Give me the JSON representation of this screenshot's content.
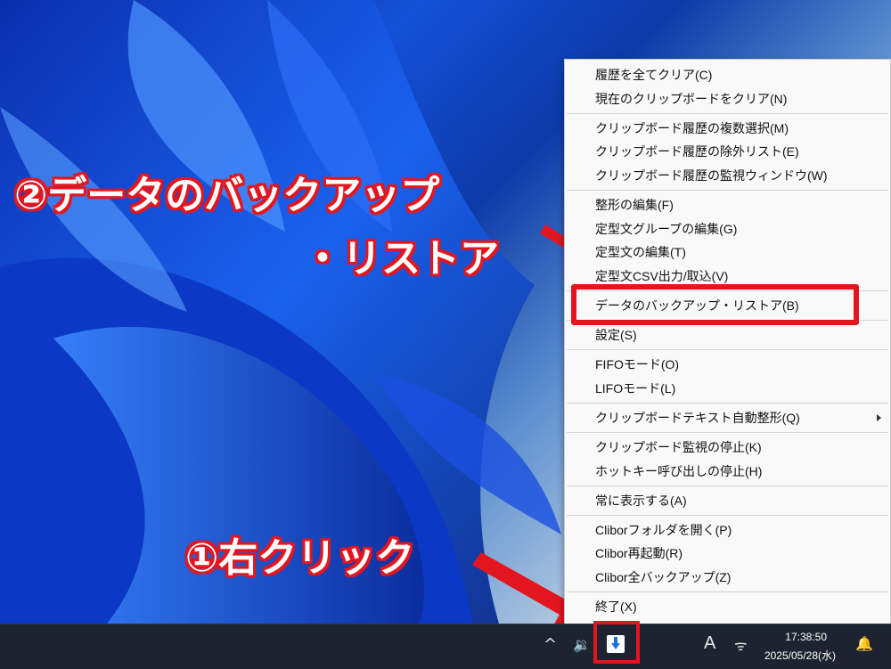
{
  "annotations": {
    "step2_line1": "②データのバックアップ",
    "step2_line2": "・リストア",
    "step1": "①右クリック"
  },
  "context_menu": {
    "groups": [
      [
        "履歴を全てクリア(C)",
        "現在のクリップボードをクリア(N)"
      ],
      [
        "クリップボード履歴の複数選択(M)",
        "クリップボード履歴の除外リスト(E)",
        "クリップボード履歴の監視ウィンドウ(W)"
      ],
      [
        "整形の編集(F)",
        "定型文グループの編集(G)",
        "定型文の編集(T)",
        "定型文CSV出力/取込(V)"
      ],
      [
        "データのバックアップ・リストア(B)"
      ],
      [
        "設定(S)"
      ],
      [
        "FIFOモード(O)",
        "LIFOモード(L)"
      ],
      [
        "クリップボードテキスト自動整形(Q)"
      ],
      [
        "クリップボード監視の停止(K)",
        "ホットキー呼び出しの停止(H)"
      ],
      [
        "常に表示する(A)"
      ],
      [
        "Cliborフォルダを開く(P)",
        "Clibor再起動(R)",
        "Clibor全バックアップ(Z)"
      ],
      [
        "終了(X)"
      ]
    ],
    "submenu_item": "クリップボードテキスト自動整形(Q)",
    "highlighted_item": "データのバックアップ・リストア(B)"
  },
  "taskbar": {
    "tray_chevron": "^",
    "volume_icon": "🔉",
    "ime_indicator": "A",
    "wifi_icon": "ᯤ",
    "time": "17:38:50",
    "date": "2025/05/28(水)",
    "notify_icon": "🔔"
  },
  "colors": {
    "annotation_red": "#e3161f",
    "taskbar_bg": "#1d2330",
    "menu_bg": "#f9f9f9"
  }
}
